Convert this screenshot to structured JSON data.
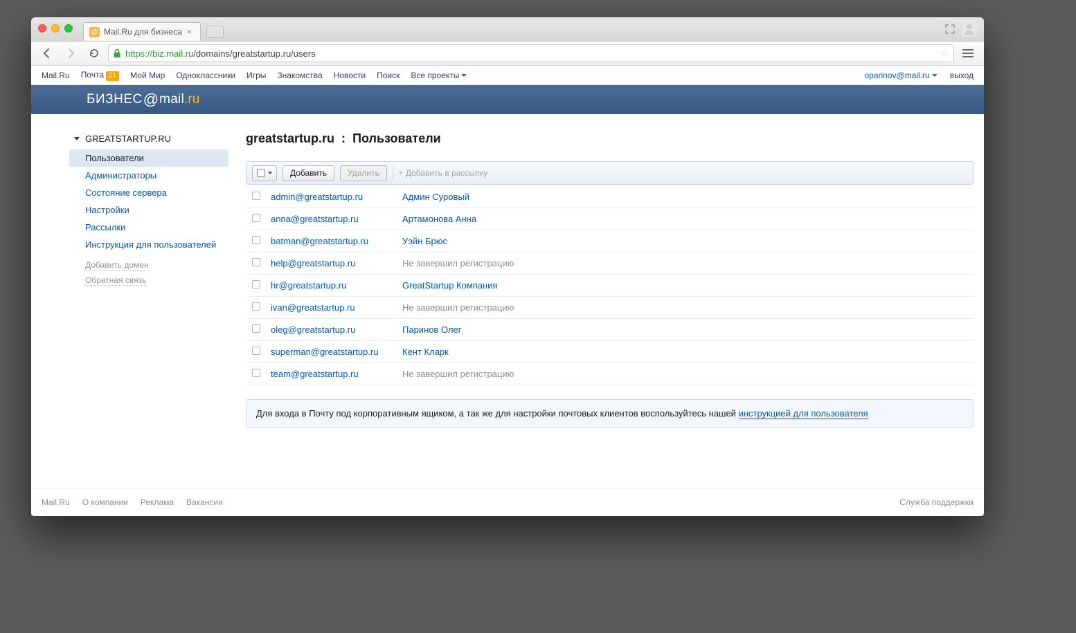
{
  "browser": {
    "tab_title": "Mail.Ru для бизнеса",
    "url_proto": "https",
    "url_host": "://biz.mail.ru",
    "url_path": "/domains/greatstartup.ru/users"
  },
  "portal": {
    "links": [
      "Mail.Ru",
      "Почта",
      "Мой Мир",
      "Одноклассники",
      "Игры",
      "Знакомства",
      "Новости",
      "Поиск",
      "Все проекты"
    ],
    "mail_badge": "21",
    "user_email": "oparinov@mail.ru",
    "logout": "выход"
  },
  "brand": {
    "biznes": "БИЗНЕС",
    "mail": "mail",
    "ru": ".ru"
  },
  "sidebar": {
    "domain": "GREATSTARTUP.RU",
    "items": [
      "Пользователи",
      "Администраторы",
      "Состояние сервера",
      "Настройки",
      "Рассылки",
      "Инструкция для пользователей"
    ],
    "active_index": 0,
    "extra": [
      "Добавить домен",
      "Обратная связь"
    ]
  },
  "page": {
    "title_domain": "greatstartup.ru",
    "title_separator": ":",
    "title_section": "Пользователи"
  },
  "toolbar": {
    "add": "Добавить",
    "delete": "Удалить",
    "add_to_list": "Добавить в рассылку"
  },
  "users": [
    {
      "email": "admin@greatstartup.ru",
      "name": "Админ Суровый",
      "pending": false
    },
    {
      "email": "anna@greatstartup.ru",
      "name": "Артамонова Анна",
      "pending": false
    },
    {
      "email": "batman@greatstartup.ru",
      "name": "Уэйн Брюс",
      "pending": false
    },
    {
      "email": "help@greatstartup.ru",
      "name": "Не завершил регистрацию",
      "pending": true
    },
    {
      "email": "hr@greatstartup.ru",
      "name": "GreatStartup Компания",
      "pending": false
    },
    {
      "email": "ivan@greatstartup.ru",
      "name": "Не завершил регистрацию",
      "pending": true
    },
    {
      "email": "oleg@greatstartup.ru",
      "name": "Паринов Олег",
      "pending": false
    },
    {
      "email": "superman@greatstartup.ru",
      "name": "Кент Кларк",
      "pending": false
    },
    {
      "email": "team@greatstartup.ru",
      "name": "Не завершил регистрацию",
      "pending": true
    }
  ],
  "info": {
    "text_before": "Для входа в Почту под корпоративным ящиком, а так же для настройки почтовых клиентов воспользуйтесь нашей ",
    "link": "инструкцией для пользователя"
  },
  "footer": {
    "left": [
      "Mail.Ru",
      "О компании",
      "Реклама",
      "Вакансии"
    ],
    "right": "Служба поддержки"
  }
}
